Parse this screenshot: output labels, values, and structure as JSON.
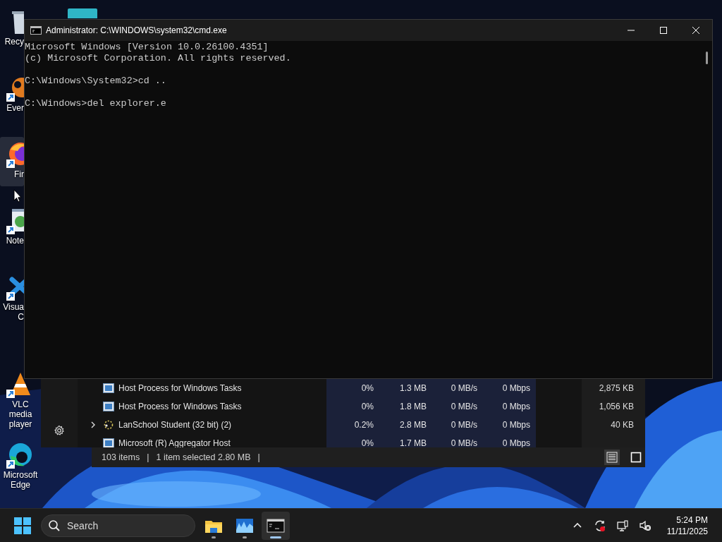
{
  "desktop_icons": [
    {
      "kind": "recycle",
      "label": "Recy",
      "clipped": true,
      "selected": false
    },
    {
      "kind": "evernote",
      "label": "Ever",
      "clipped": true,
      "selected": false
    },
    {
      "kind": "firefox",
      "label": "Fir",
      "clipped": true,
      "selected": true
    },
    {
      "kind": "notepad",
      "label": "Note",
      "clipped": true,
      "selected": false
    },
    {
      "kind": "vscode",
      "label": "Visua\nC",
      "clipped": true,
      "selected": false
    },
    {
      "kind": "vlc",
      "label": "VLC media player",
      "clipped": false,
      "selected": false
    },
    {
      "kind": "edge",
      "label": "Microsoft Edge",
      "clipped": false,
      "selected": false
    }
  ],
  "console_window": {
    "title": "Administrator: C:\\WINDOWS\\system32\\cmd.exe",
    "blocks": [
      [
        "Microsoft Windows [Version 10.0.26100.4351]",
        "(c) Microsoft Corporation. All rights reserved."
      ],
      [
        "C:\\Windows\\System32>cd .."
      ],
      [
        "C:\\Windows>del explorer.e"
      ]
    ]
  },
  "task_manager": {
    "rows": [
      {
        "kind": "host",
        "expandable": false,
        "name": "Host Process for Windows Tasks",
        "cpu": "0%",
        "memory": "1.3 MB",
        "disk": "0 MB/s",
        "network": "0 Mbps",
        "column_6": "2,875 KB"
      },
      {
        "kind": "host",
        "expandable": false,
        "name": "Host Process for Windows Tasks",
        "cpu": "0%",
        "memory": "1.8 MB",
        "disk": "0 MB/s",
        "network": "0 Mbps",
        "column_6": "1,056 KB"
      },
      {
        "kind": "lanschool",
        "expandable": true,
        "name": "LanSchool Student (32 bit) (2)",
        "cpu": "0.2%",
        "memory": "2.8 MB",
        "disk": "0 MB/s",
        "network": "0 Mbps",
        "column_6": "40 KB"
      },
      {
        "kind": "host",
        "expandable": false,
        "name": "Microsoft (R) Aggregator Host",
        "cpu": "0%",
        "memory": "1.7 MB",
        "disk": "0 MB/s",
        "network": "0 Mbps"
      }
    ],
    "status_bar": [
      "103 items",
      "|",
      "1 item selected  2.80 MB",
      "|"
    ],
    "view_buttons": [
      {
        "kind": "details",
        "selected": true
      },
      {
        "kind": "compact",
        "selected": false
      }
    ]
  },
  "taskbar": {
    "search": {
      "placeholder": "Search"
    },
    "apps": [
      {
        "kind": "explorer",
        "active": false
      },
      {
        "kind": "monitor",
        "active": false
      },
      {
        "kind": "terminal",
        "active": true
      }
    ],
    "clock": {
      "time": "5:24 PM",
      "date": "11/11/2025"
    }
  }
}
